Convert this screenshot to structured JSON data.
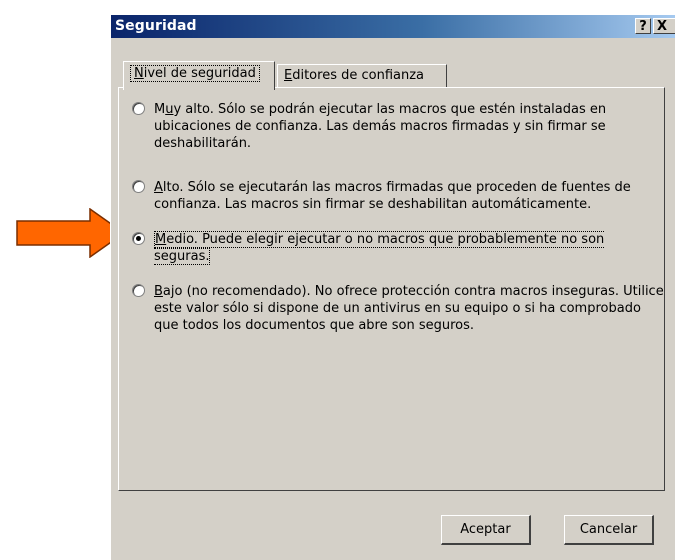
{
  "window": {
    "title": "Seguridad",
    "help_label": "?",
    "close_label": "X"
  },
  "tabs": [
    {
      "pre": "",
      "accel": "N",
      "post": "ivel de seguridad"
    },
    {
      "pre": "",
      "accel": "E",
      "post": "ditores de confianza"
    }
  ],
  "options": [
    {
      "pre": "M",
      "accel": "u",
      "post": "y alto. Sólo se podrán ejecutar las macros que estén instaladas en ubicaciones de confianza. Las demás macros firmadas y sin firmar se deshabilitarán.",
      "selected": false
    },
    {
      "pre": "",
      "accel": "A",
      "post": "lto. Sólo se ejecutarán las macros firmadas que proceden de fuentes de confianza. Las macros sin firmar se deshabilitan automáticamente.",
      "selected": false
    },
    {
      "pre": "",
      "accel": "M",
      "post": "edio. Puede elegir ejecutar o no macros que probablemente no son seguras.",
      "selected": true
    },
    {
      "pre": "",
      "accel": "B",
      "post": "ajo (no recomendado). No ofrece protección contra macros inseguras. Utilice este valor sólo si dispone de un antivirus en su equipo o si ha comprobado que todos los documentos que abre son seguros.",
      "selected": false
    }
  ],
  "buttons": {
    "ok": "Aceptar",
    "cancel": "Cancelar"
  },
  "colors": {
    "dialog_bg": "#d4d0c8",
    "titlebar": "#0a246a",
    "arrow_fill": "#ff6600",
    "arrow_stroke": "#7a2e00"
  },
  "icons": {
    "annotation": "orange-arrow-icon"
  }
}
